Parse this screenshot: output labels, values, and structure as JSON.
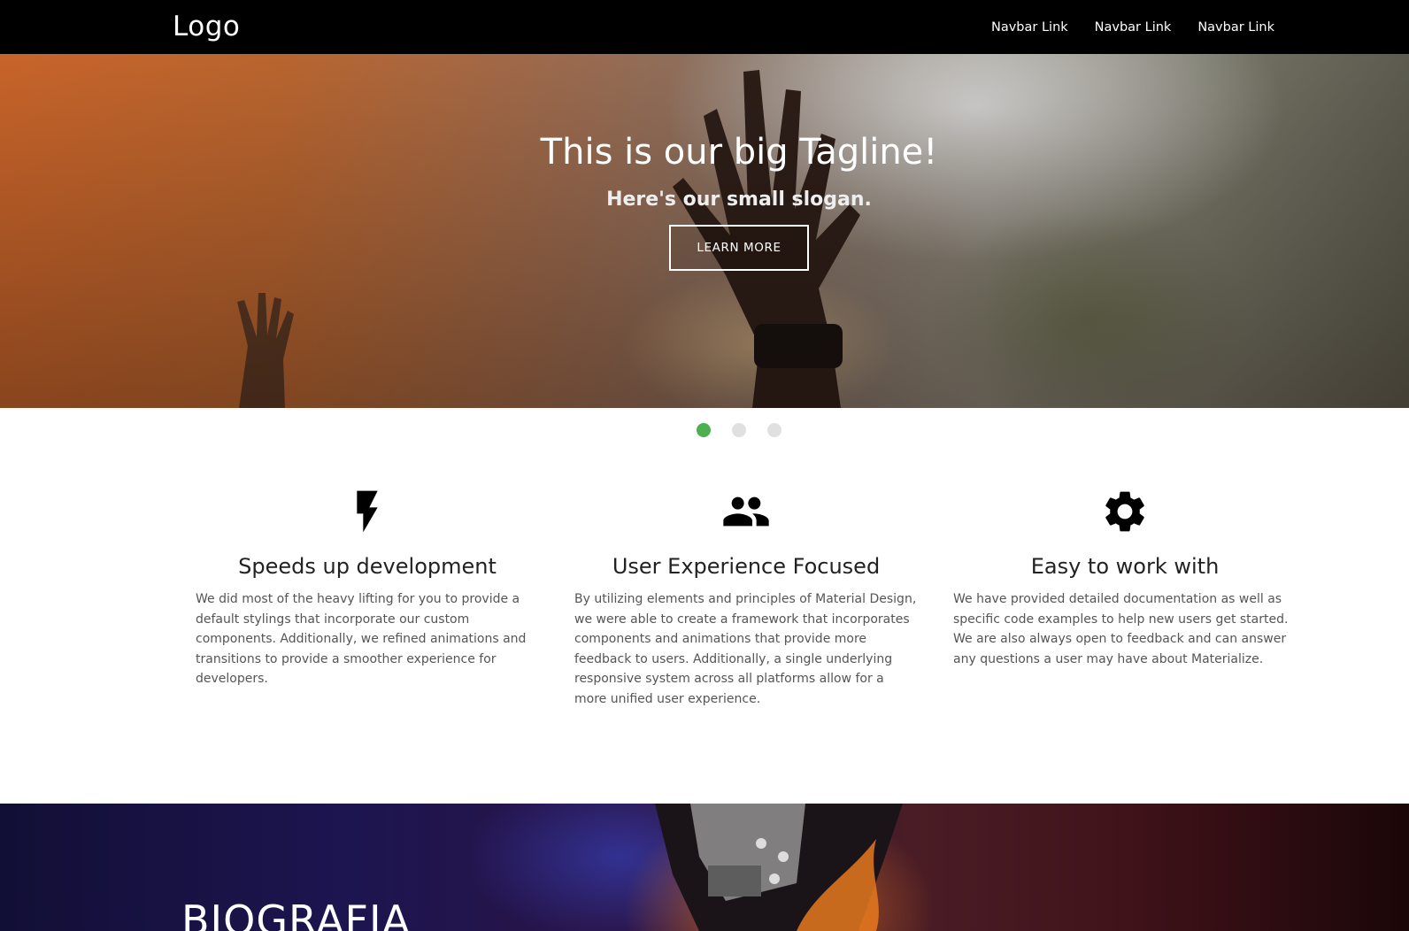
{
  "navbar": {
    "logo": "Logo",
    "links": [
      "Navbar Link",
      "Navbar Link",
      "Navbar Link"
    ]
  },
  "hero": {
    "title": "This is our big Tagline!",
    "slogan": "Here's our small slogan.",
    "button": "LEARN MORE"
  },
  "slider": {
    "active_index": 0,
    "count": 3,
    "active_color": "#4caf50",
    "inactive_color": "#e0e0e0"
  },
  "features": [
    {
      "icon": "flash-icon",
      "title": "Speeds up development",
      "text": "We did most of the heavy lifting for you to provide a default stylings that incorporate our custom components. Additionally, we refined animations and transitions to provide a smoother experience for developers."
    },
    {
      "icon": "group-icon",
      "title": "User Experience Focused",
      "text": "By utilizing elements and principles of Material Design, we were able to create a framework that incorporates components and animations that provide more feedback to users. Additionally, a single underlying responsive system across all platforms allow for a more unified user experience."
    },
    {
      "icon": "settings-icon",
      "title": "Easy to work with",
      "text": "We have provided detailed documentation as well as specific code examples to help new users get started. We are also always open to feedback and can answer any questions a user may have about Materialize."
    }
  ],
  "bio": {
    "title": "BIOGRAFIA"
  }
}
